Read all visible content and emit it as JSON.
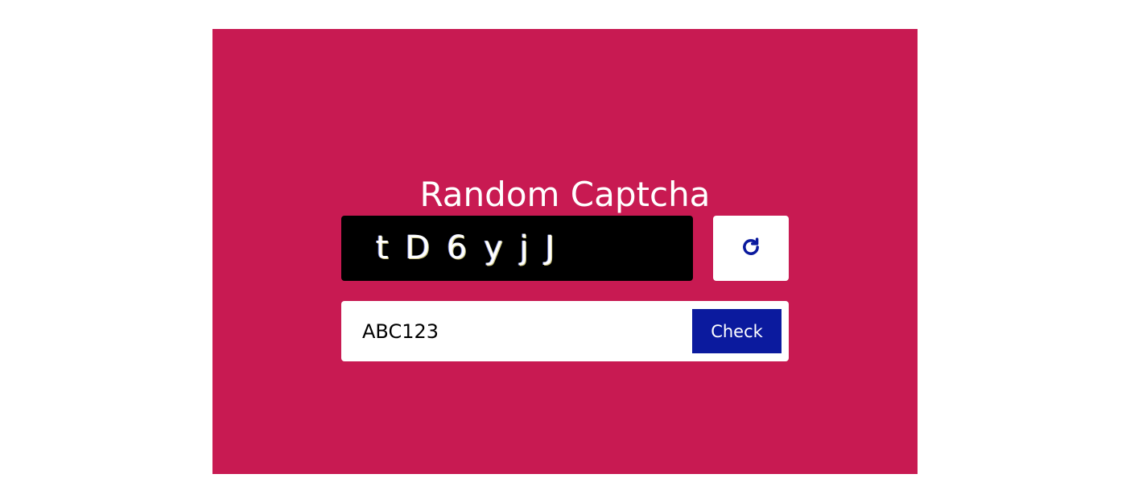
{
  "app": {
    "title": "Random Captcha"
  },
  "captcha": {
    "text": "t D 6 y j J",
    "refresh_icon": "refresh-icon"
  },
  "form": {
    "input_value": "ABC123",
    "check_label": "Check"
  },
  "colors": {
    "panel_background": "#c81a52",
    "captcha_background": "#000000",
    "accent": "#0b1a9e",
    "text_light": "#ffffff"
  }
}
